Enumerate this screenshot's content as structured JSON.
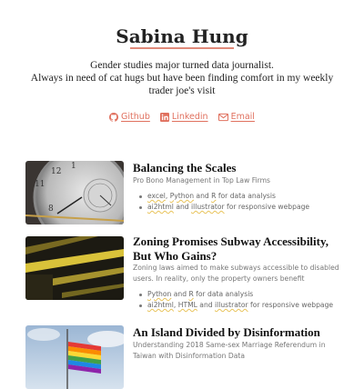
{
  "profile": {
    "name": "Sabina Hung",
    "bio_lines": [
      "Gender studies major turned data journalist.",
      "Always in need of cat hugs but have been finding comfort in my weekly",
      "trader joe's visit"
    ]
  },
  "links": [
    {
      "label": "Github",
      "icon": "github-icon"
    },
    {
      "label": "Linkedin",
      "icon": "linkedin-icon"
    },
    {
      "label": "Email",
      "icon": "email-icon"
    }
  ],
  "colors": {
    "accent": "#e0705e",
    "underline": "#e8c35a"
  },
  "projects": [
    {
      "title": "Balancing the Scales",
      "subtitle": "Pro Bono Management in Top Law Firms",
      "bullets": [
        {
          "tools": [
            "excel",
            "Python",
            "R"
          ],
          "connectors": [
            ", ",
            " and ",
            ""
          ],
          "suffix": " for data analysis"
        },
        {
          "tools": [
            "ai2html",
            "illustrator"
          ],
          "connectors": [
            " and ",
            ""
          ],
          "suffix": " for responsive webpage"
        }
      ]
    },
    {
      "title": "Zoning Promises Subway Accessibility, But Who Gains?",
      "subtitle": "Zoning laws aimed to make subways accessible to disabled users. In reality, only the property owners benefit",
      "bullets": [
        {
          "tools": [
            "Python",
            "R"
          ],
          "connectors": [
            " and ",
            ""
          ],
          "suffix": " for data analysis"
        },
        {
          "tools": [
            "ai2html",
            "HTML",
            "illustrator"
          ],
          "connectors": [
            ", ",
            " and ",
            ""
          ],
          "suffix": " for responsive webpage"
        }
      ]
    },
    {
      "title": "An Island Divided by Disinformation",
      "subtitle": "Understanding 2018 Same-sex Marriage Referendum in Taiwan with Disinformation Data",
      "bullets": []
    }
  ]
}
